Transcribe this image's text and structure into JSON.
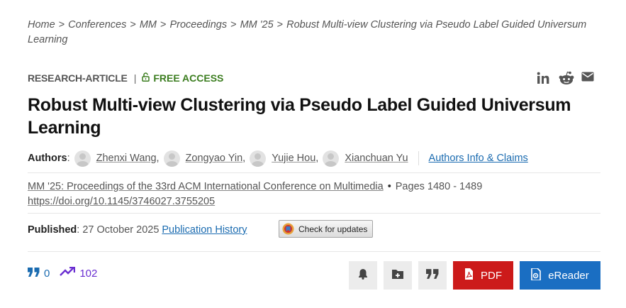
{
  "breadcrumb": {
    "items": [
      "Home",
      "Conferences",
      "MM",
      "Proceedings",
      "MM '25",
      "Robust Multi-view Clustering via Pseudo Label Guided Universum Learning"
    ],
    "separator": ">"
  },
  "article": {
    "type": "RESEARCH-ARTICLE",
    "access": "FREE ACCESS",
    "title": "Robust Multi-view Clustering via Pseudo Label Guided Universum Learning"
  },
  "share": {
    "icons": [
      "linkedin-icon",
      "reddit-icon",
      "email-icon"
    ]
  },
  "authors": {
    "label": "Authors",
    "list": [
      "Zhenxi Wang",
      "Zongyao Yin",
      "Yujie Hou",
      "Xianchuan Yu"
    ],
    "info_link": "Authors Info & Claims"
  },
  "venue": {
    "proceedings": "MM '25: Proceedings of the 33rd ACM International Conference on Multimedia",
    "pages": "Pages 1480 - 1489",
    "doi": "https://doi.org/10.1145/3746027.3755205"
  },
  "published": {
    "label": "Published",
    "date": "27 October 2025",
    "history_link": "Publication History"
  },
  "check_updates": "Check for updates",
  "metrics": {
    "citations": "0",
    "downloads": "102"
  },
  "actions": {
    "pdf": "PDF",
    "ereader": "eReader"
  },
  "colors": {
    "link": "#1a6bb0",
    "free_access": "#3b7d1f",
    "pdf": "#cc1a1a",
    "ereader": "#1a6ec2",
    "views": "#6a2ed1"
  }
}
